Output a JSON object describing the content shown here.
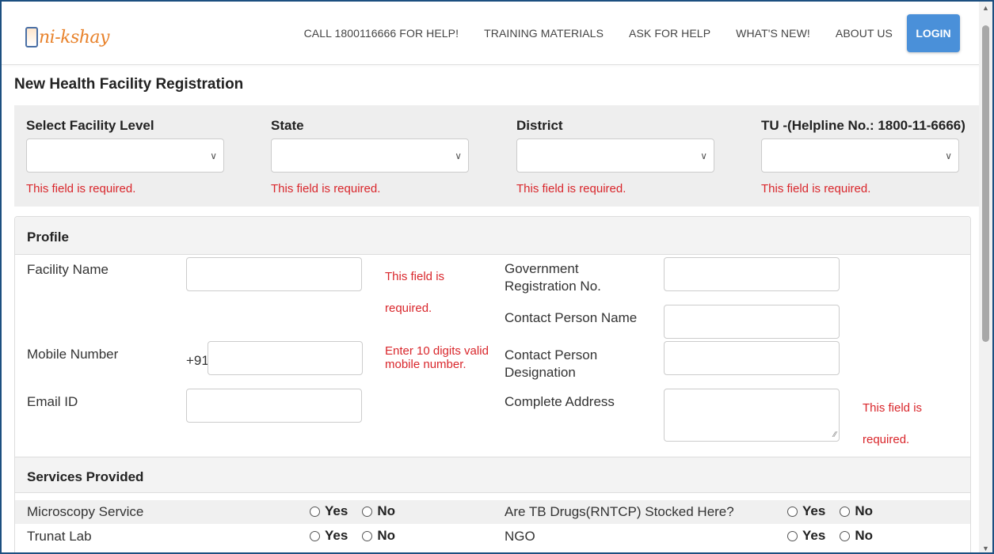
{
  "header": {
    "logo_text": "ni-kshay",
    "nav": [
      "CALL 1800116666 FOR HELP!",
      "TRAINING MATERIALS",
      "ASK FOR HELP",
      "WHAT'S NEW!",
      "ABOUT US"
    ],
    "login_label": "LOGIN"
  },
  "page": {
    "title": "New Health Facility Registration"
  },
  "location": {
    "fields": [
      {
        "label": "Select Facility Level",
        "error": "This field is required."
      },
      {
        "label": "State",
        "error": "This field is required."
      },
      {
        "label": "District",
        "error": "This field is required."
      },
      {
        "label": "TU -(Helpline No.: 1800-11-6666)",
        "error": "This field is required."
      }
    ]
  },
  "profile": {
    "heading": "Profile",
    "facility_name_label": "Facility Name",
    "facility_name_error": "This field is required.",
    "mobile_label": "Mobile Number",
    "mobile_prefix": "+91",
    "mobile_error": "Enter 10 digits valid mobile number.",
    "email_label": "Email ID",
    "gov_reg_label": "Government Registration No.",
    "contact_name_label": "Contact Person Name",
    "contact_designation_label": "Contact Person Designation",
    "address_label": "Complete Address",
    "address_error": "This field is required."
  },
  "services": {
    "heading": "Services Provided",
    "yes_label": "Yes",
    "no_label": "No",
    "rows": [
      {
        "left": "Microscopy Service",
        "right": "Are TB Drugs(RNTCP) Stocked Here?"
      },
      {
        "left": "Trunat Lab",
        "right": "NGO"
      }
    ]
  },
  "colors": {
    "error": "#d9262b",
    "login_button": "#4a90d9",
    "logo": "#e8822b",
    "window_border": "#1c4f80"
  }
}
